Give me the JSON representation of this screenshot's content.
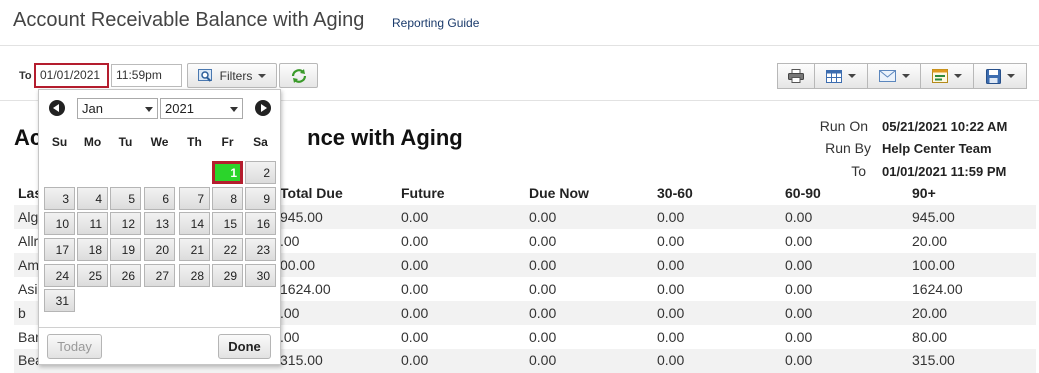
{
  "page": {
    "title": "Account Receivable Balance with Aging",
    "guide_link": "Reporting Guide"
  },
  "controls": {
    "to_label": "To",
    "date_value": "01/01/2021",
    "time_value": "11:59pm",
    "filters_label": "Filters"
  },
  "toolbar_icons": [
    "print-icon",
    "grid-icon",
    "email-icon",
    "export-icon",
    "save-icon"
  ],
  "report": {
    "title_visible": "Ac",
    "title_tail": "nce with Aging",
    "run_on_label": "Run On",
    "run_on_value": "05/21/2021 10:22 AM",
    "run_by_label": "Run By",
    "run_by_value": "Help Center Team",
    "to_label": "To",
    "to_value": "01/01/2021 11:59 PM"
  },
  "table": {
    "headers": [
      "Las",
      "Total Due",
      "Future",
      "Due Now",
      "30-60",
      "60-90",
      "90+"
    ],
    "rows": [
      {
        "name": "Alg",
        "total": "945.00",
        "future": "0.00",
        "due_now": "0.00",
        "d30": "0.00",
        "d60": "0.00",
        "d90": "945.00"
      },
      {
        "name": "Allr",
        "total": ".00",
        "future": "0.00",
        "due_now": "0.00",
        "d30": "0.00",
        "d60": "0.00",
        "d90": "20.00"
      },
      {
        "name": "Am",
        "total": "00.00",
        "future": "0.00",
        "due_now": "0.00",
        "d30": "0.00",
        "d60": "0.00",
        "d90": "100.00"
      },
      {
        "name": "Asi",
        "total": "1624.00",
        "future": "0.00",
        "due_now": "0.00",
        "d30": "0.00",
        "d60": "0.00",
        "d90": "1624.00"
      },
      {
        "name": "b",
        "total": ".00",
        "future": "0.00",
        "due_now": "0.00",
        "d30": "0.00",
        "d60": "0.00",
        "d90": "20.00"
      },
      {
        "name": "Bar",
        "total": ".00",
        "future": "0.00",
        "due_now": "0.00",
        "d30": "0.00",
        "d60": "0.00",
        "d90": "80.00"
      },
      {
        "name": "Bea",
        "total": "315.00",
        "future": "0.00",
        "due_now": "0.00",
        "d30": "0.00",
        "d60": "0.00",
        "d90": "315.00"
      }
    ]
  },
  "calendar": {
    "month": "Jan",
    "year": "2021",
    "weekdays": [
      "Su",
      "Mo",
      "Tu",
      "We",
      "Th",
      "Fr",
      "Sa"
    ],
    "weeks": [
      [
        "",
        "",
        "",
        "",
        "",
        "1",
        "2"
      ],
      [
        "3",
        "4",
        "5",
        "6",
        "7",
        "8",
        "9"
      ],
      [
        "10",
        "11",
        "12",
        "13",
        "14",
        "15",
        "16"
      ],
      [
        "17",
        "18",
        "19",
        "20",
        "21",
        "22",
        "23"
      ],
      [
        "24",
        "25",
        "26",
        "27",
        "28",
        "29",
        "30"
      ],
      [
        "31",
        "",
        "",
        "",
        "",
        "",
        ""
      ]
    ],
    "selected_day": "1",
    "today_label": "Today",
    "done_label": "Done"
  },
  "colors": {
    "highlight_border": "#b41d2e",
    "selected_day_bg": "#2bd42b",
    "refresh_green": "#3a9a2a"
  }
}
